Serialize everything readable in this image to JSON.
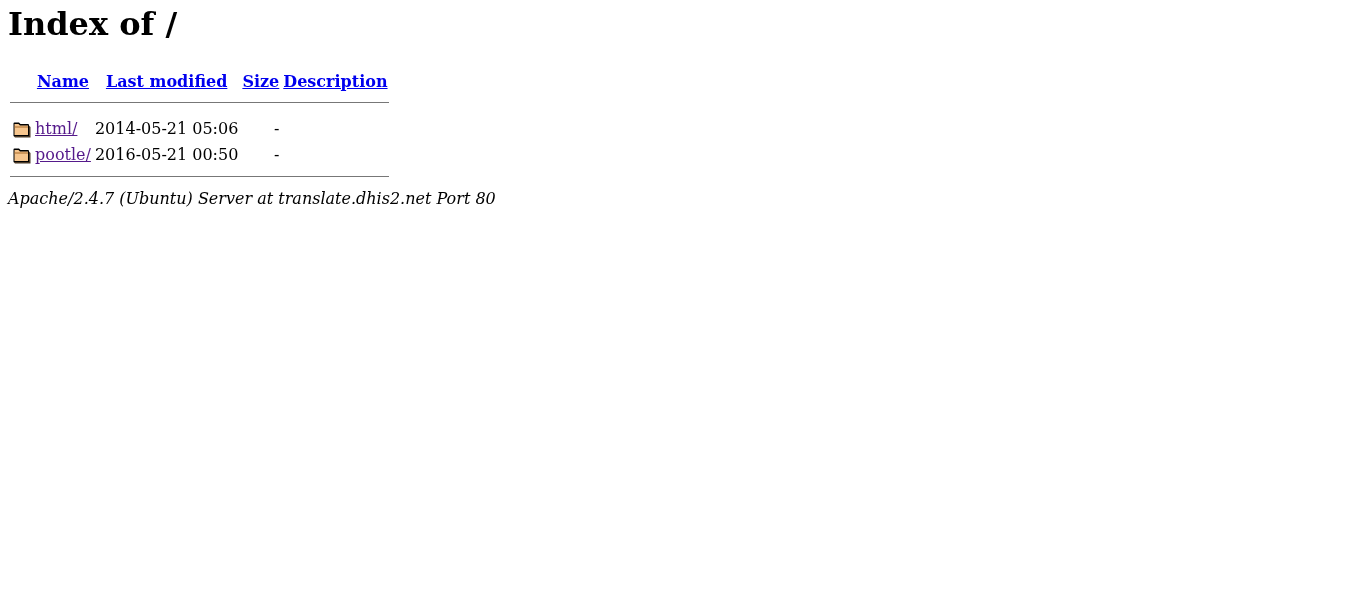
{
  "title": "Index of /",
  "columns": [
    "Name",
    "Last modified",
    "Size",
    "Description"
  ],
  "rows": [
    {
      "kind": "folder",
      "name": "html/",
      "visited": true,
      "modified": "2014-05-21 05:06",
      "size": "-"
    },
    {
      "kind": "folder",
      "name": "pootle/",
      "visited": true,
      "modified": "2016-05-21 00:50",
      "size": "-"
    }
  ],
  "footer": "Apache/2.4.7 (Ubuntu) Server at translate.dhis2.net Port 80"
}
